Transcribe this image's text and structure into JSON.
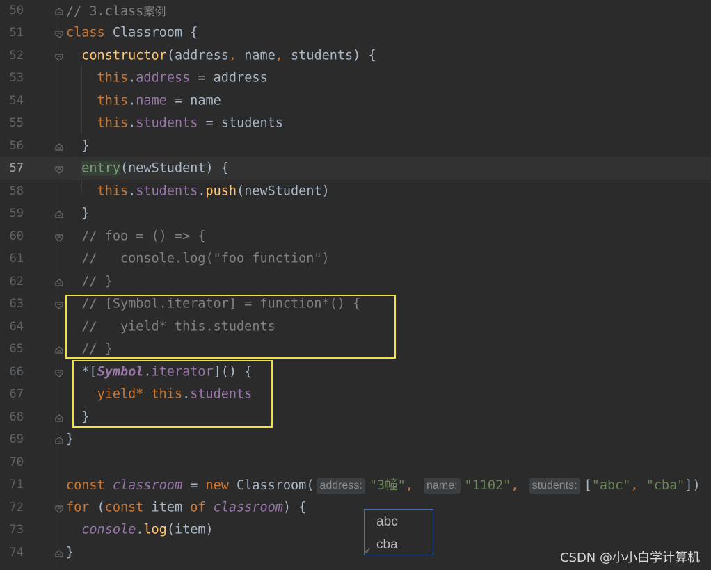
{
  "editor": {
    "current_line": "57",
    "lines": [
      {
        "n": "50"
      },
      {
        "n": "51"
      },
      {
        "n": "52"
      },
      {
        "n": "53"
      },
      {
        "n": "54"
      },
      {
        "n": "55"
      },
      {
        "n": "56"
      },
      {
        "n": "57"
      },
      {
        "n": "58"
      },
      {
        "n": "59"
      },
      {
        "n": "60"
      },
      {
        "n": "61"
      },
      {
        "n": "62"
      },
      {
        "n": "63"
      },
      {
        "n": "64"
      },
      {
        "n": "65"
      },
      {
        "n": "66"
      },
      {
        "n": "67"
      },
      {
        "n": "68"
      },
      {
        "n": "69"
      },
      {
        "n": "70"
      },
      {
        "n": "71"
      },
      {
        "n": "72"
      },
      {
        "n": "73"
      },
      {
        "n": "74"
      }
    ],
    "code": {
      "l50_comment_prefix": "// 3.class",
      "l50_comment_cn": "案例",
      "l51_class": "class",
      "l51_name": " Classroom {",
      "l52_ctor": "constructor",
      "l52_open": "(address",
      "l52_c1": ",",
      "l52_name": " name",
      "l52_c2": ",",
      "l52_rest": " students) {",
      "l53_this": "this",
      "l53_dot": ".",
      "l53_prop": "address",
      "l53_rest": " = address",
      "l54_this": "this",
      "l54_dot": ".",
      "l54_prop": "name",
      "l54_rest": " = name",
      "l55_this": "this",
      "l55_dot": ".",
      "l55_prop": "students",
      "l55_rest": " = students",
      "l56": "}",
      "l57_method": "entry",
      "l57_rest": "(newStudent) {",
      "l58_this": "this",
      "l58_dot": ".",
      "l58_prop": "students",
      "l58_dot2": ".",
      "l58_fn": "push",
      "l58_rest": "(newStudent)",
      "l59": "}",
      "l60": "// foo = () => {",
      "l61": "//   console.log(\"foo function\")",
      "l62": "// }",
      "l63": "// [Symbol.iterator] = function*() {",
      "l64": "//   yield* this.students",
      "l65": "// }",
      "l66_star": "*[",
      "l66_symbol": "Symbol",
      "l66_dot": ".",
      "l66_iter": "iterator",
      "l66_rest": "]() {",
      "l67_yield": "yield*",
      "l67_this": " this",
      "l67_dot": ".",
      "l67_prop": "students",
      "l68": "}",
      "l69": "}",
      "l71_const": "const",
      "l71_var": " classroom",
      "l71_eq": " = ",
      "l71_new": "new",
      "l71_cls": " Classroom(",
      "l71_h1": "address:",
      "l71_a1": "\"3幢\"",
      "l71_c1": ", ",
      "l71_h2": "name:",
      "l71_a2": "\"1102\"",
      "l71_c2": ", ",
      "l71_h3": "students:",
      "l71_ob": "[",
      "l71_s1": "\"abc\"",
      "l71_sc": ", ",
      "l71_s2": "\"cba\"",
      "l71_cb": "])",
      "l72_for": "for",
      "l72_open": " (",
      "l72_const": "const",
      "l72_item": " item ",
      "l72_of": "of",
      "l72_var": " classroom",
      "l72_rest": ") {",
      "l73_console": "console",
      "l73_dot": ".",
      "l73_log": "log",
      "l73_rest": "(item)",
      "l74": "}"
    }
  },
  "output_popup": {
    "items": [
      "abc",
      "cba"
    ]
  },
  "watermark": "CSDN @小小白学计算机"
}
